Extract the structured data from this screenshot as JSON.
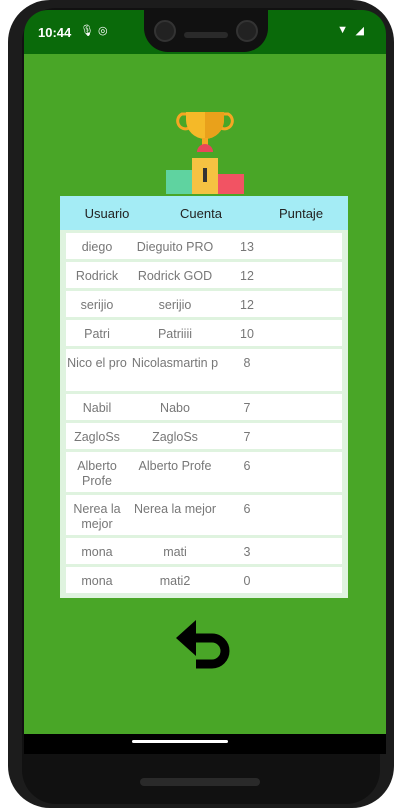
{
  "status": {
    "time": "10:44"
  },
  "table": {
    "headers": [
      "Usuario",
      "Cuenta",
      "Puntaje"
    ],
    "rows": [
      {
        "usuario": "diego",
        "cuenta": "Dieguito PRO",
        "puntaje": "13"
      },
      {
        "usuario": "Rodrick",
        "cuenta": "Rodrick GOD",
        "puntaje": "12"
      },
      {
        "usuario": "serijio",
        "cuenta": "serijio",
        "puntaje": "12"
      },
      {
        "usuario": "Patri",
        "cuenta": "Patriiii",
        "puntaje": "10"
      },
      {
        "usuario": "Nico el pro",
        "cuenta": "Nicolasmartin p",
        "puntaje": "8"
      },
      {
        "usuario": "Nabil",
        "cuenta": "Nabo",
        "puntaje": "7"
      },
      {
        "usuario": "ZagloSs",
        "cuenta": "ZagloSs",
        "puntaje": "7"
      },
      {
        "usuario": "Alberto Profe",
        "cuenta": "Alberto Profe",
        "puntaje": "6"
      },
      {
        "usuario": "Nerea la mejor",
        "cuenta": "Nerea la mejor",
        "puntaje": "6"
      },
      {
        "usuario": "mona",
        "cuenta": "mati",
        "puntaje": "3"
      },
      {
        "usuario": "mona",
        "cuenta": "mati2",
        "puntaje": "0"
      }
    ]
  },
  "icons": {
    "trophy": "trophy-podium-icon",
    "back": "undo-arrow-icon"
  },
  "colors": {
    "background": "#49a627",
    "header": "#a4ecf5",
    "statusbar": "#0a6a0a"
  }
}
